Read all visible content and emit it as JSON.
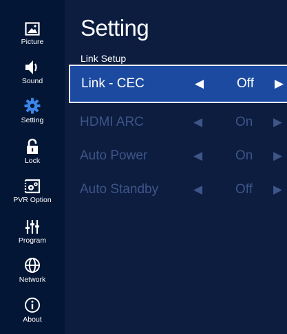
{
  "sidebar": {
    "items": [
      {
        "label": "Picture",
        "icon": "picture-icon"
      },
      {
        "label": "Sound",
        "icon": "speaker-icon"
      },
      {
        "label": "Setting",
        "icon": "gear-icon"
      },
      {
        "label": "Lock",
        "icon": "lock-icon"
      },
      {
        "label": "PVR Option",
        "icon": "pvr-icon"
      },
      {
        "label": "Program",
        "icon": "equalizer-icon"
      },
      {
        "label": "Network",
        "icon": "globe-icon"
      },
      {
        "label": "About",
        "icon": "info-icon"
      }
    ]
  },
  "main": {
    "title": "Setting",
    "subtitle": "Link Setup",
    "rows": [
      {
        "label": "Link - CEC",
        "value": "Off",
        "left_arrow": "◀",
        "right_arrow": "▶",
        "state": "focused"
      },
      {
        "label": "HDMI ARC",
        "value": "On",
        "left_arrow": "◀",
        "right_arrow": "▶",
        "state": "disabled"
      },
      {
        "label": "Auto Power",
        "value": "On",
        "left_arrow": "◀",
        "right_arrow": "▶",
        "state": "disabled"
      },
      {
        "label": "Auto Standby",
        "value": "Off",
        "left_arrow": "◀",
        "right_arrow": "▶",
        "state": "disabled"
      }
    ]
  },
  "colors": {
    "background": "#0c1d40",
    "sidebar": "#031635",
    "focus_fill": "#1c4aa0",
    "focus_border": "#ffffff",
    "disabled_text": "#3e5587",
    "setting_icon": "#3a86e8"
  }
}
